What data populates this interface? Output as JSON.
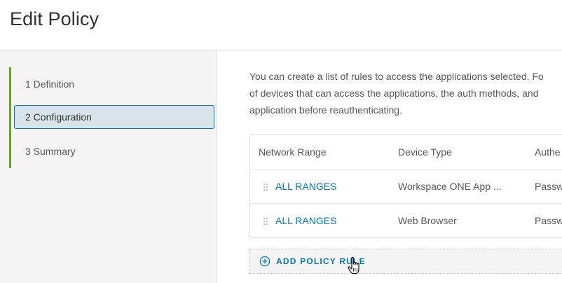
{
  "header": {
    "title": "Edit Policy"
  },
  "steps": [
    {
      "label": "1  Definition"
    },
    {
      "label": "2  Configuration"
    },
    {
      "label": "3  Summary"
    }
  ],
  "intro": {
    "line1": "You can create a list of rules to access the applications selected. Fo",
    "line2": "of devices that can access the applications, the auth methods, and",
    "line3": "application before reauthenticating."
  },
  "table": {
    "columns": [
      "Network Range",
      "Device Type",
      "Authe"
    ],
    "rows": [
      {
        "network_range": "ALL RANGES",
        "device_type": "Workspace ONE App ...",
        "auth": "Passw"
      },
      {
        "network_range": "ALL RANGES",
        "device_type": "Web Browser",
        "auth": "Passw"
      }
    ]
  },
  "add_rule": {
    "label": "ADD POLICY RULE"
  },
  "icons": [
    "drag-handle-icon",
    "plus-circle-icon",
    "hand-pointer-cursor-icon"
  ],
  "colors": {
    "accent": "#0079b8",
    "step_progress": "#62a420",
    "active_step_bg": "#d9e4ea"
  }
}
